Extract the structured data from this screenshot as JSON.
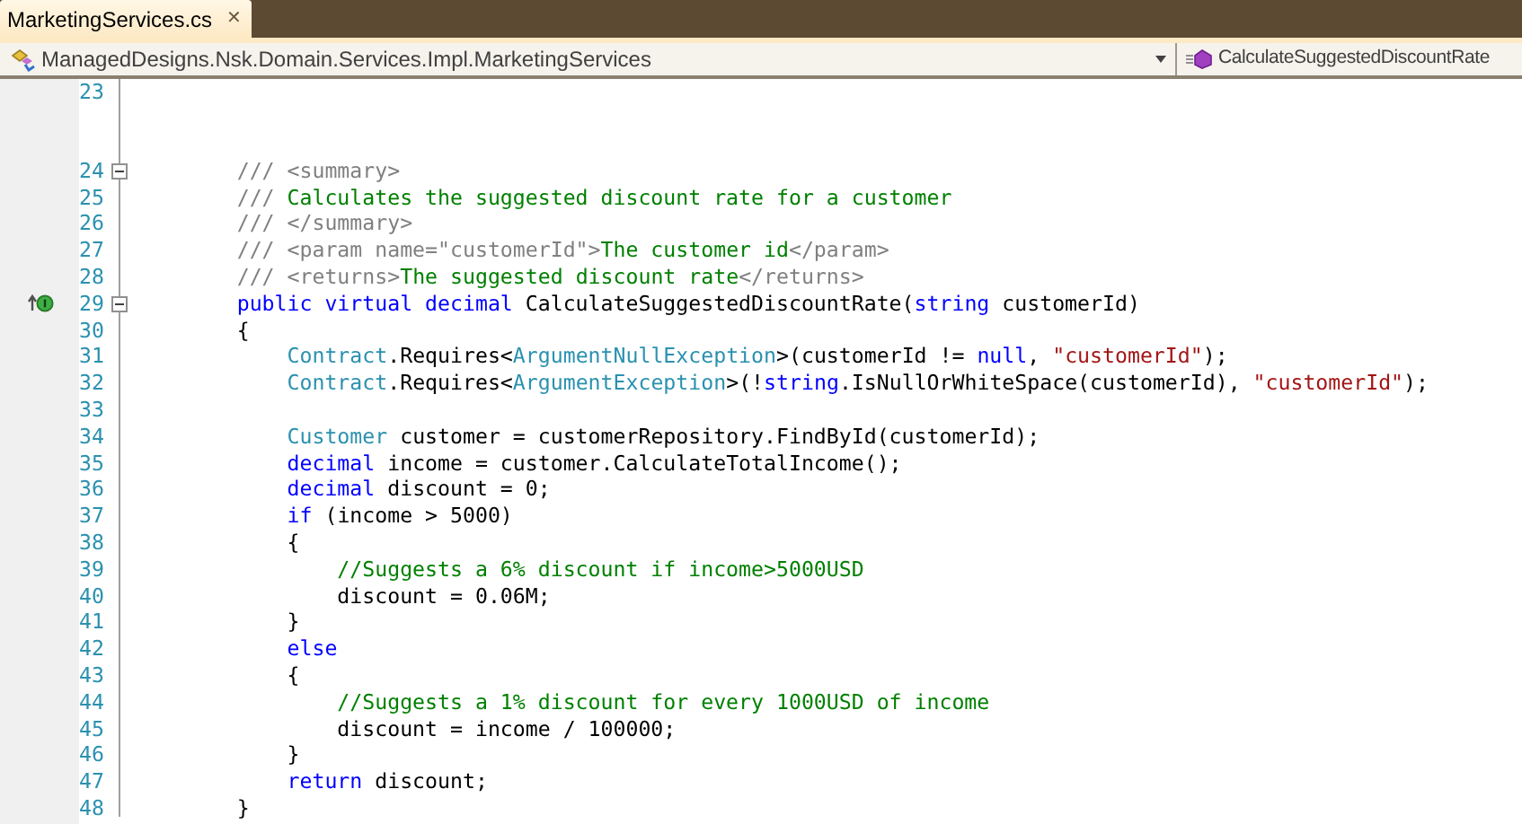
{
  "tab": {
    "title": "MarketingServices.cs",
    "close": "✕"
  },
  "navigation": {
    "type_dropdown": "ManagedDesigns.Nsk.Domain.Services.Impl.MarketingServices",
    "member_dropdown": "CalculateSuggestedDiscountRate"
  },
  "editor": {
    "lines": [
      {
        "number": "23"
      },
      {
        "number": "24",
        "expanded": true,
        "tokens": [
          {
            "kind": "doc",
            "text": "        /// <summary>"
          }
        ]
      },
      {
        "number": "25",
        "tokens": [
          {
            "kind": "doc",
            "text": "        ///"
          },
          {
            "kind": "comment",
            "text": " Calculates the suggested discount rate for a customer"
          }
        ]
      },
      {
        "number": "26",
        "tokens": [
          {
            "kind": "doc",
            "text": "        /// </summary>"
          }
        ]
      },
      {
        "number": "27",
        "tokens": [
          {
            "kind": "doc",
            "text": "        /// <param name=\"customerId\">"
          },
          {
            "kind": "comment",
            "text": "The customer id"
          },
          {
            "kind": "doc",
            "text": "</param>"
          }
        ]
      },
      {
        "number": "28",
        "tokens": [
          {
            "kind": "doc",
            "text": "        /// <returns>"
          },
          {
            "kind": "comment",
            "text": "The suggested discount rate"
          },
          {
            "kind": "doc",
            "text": "</returns>"
          }
        ]
      },
      {
        "number": "29",
        "expanded": true,
        "implementation_marker": true,
        "tokens": [
          {
            "kind": "keyword",
            "text": "        public virtual decimal"
          },
          {
            "kind": "plain",
            "text": " CalculateSuggestedDiscountRate("
          },
          {
            "kind": "keyword",
            "text": "string"
          },
          {
            "kind": "plain",
            "text": " customerId)"
          }
        ]
      },
      {
        "number": "30",
        "tokens": [
          {
            "kind": "plain",
            "text": "        {"
          }
        ]
      },
      {
        "number": "31",
        "tokens": [
          {
            "kind": "type",
            "text": "            Contract"
          },
          {
            "kind": "plain",
            "text": ".Requires<"
          },
          {
            "kind": "type",
            "text": "ArgumentNullException"
          },
          {
            "kind": "plain",
            "text": ">(customerId != "
          },
          {
            "kind": "keyword",
            "text": "null"
          },
          {
            "kind": "plain",
            "text": ", "
          },
          {
            "kind": "string",
            "text": "\"customerId\""
          },
          {
            "kind": "plain",
            "text": ");"
          }
        ]
      },
      {
        "number": "32",
        "tokens": [
          {
            "kind": "type",
            "text": "            Contract"
          },
          {
            "kind": "plain",
            "text": ".Requires<"
          },
          {
            "kind": "type",
            "text": "ArgumentException"
          },
          {
            "kind": "plain",
            "text": ">(!"
          },
          {
            "kind": "keyword",
            "text": "string"
          },
          {
            "kind": "plain",
            "text": ".IsNullOrWhiteSpace(customerId), "
          },
          {
            "kind": "string",
            "text": "\"customerId\""
          },
          {
            "kind": "plain",
            "text": ");"
          }
        ]
      },
      {
        "number": "33"
      },
      {
        "number": "34",
        "tokens": [
          {
            "kind": "type",
            "text": "            Customer"
          },
          {
            "kind": "plain",
            "text": " customer = customerRepository.FindById(customerId);"
          }
        ]
      },
      {
        "number": "35",
        "tokens": [
          {
            "kind": "keyword",
            "text": "            decimal"
          },
          {
            "kind": "plain",
            "text": " income = customer.CalculateTotalIncome();"
          }
        ]
      },
      {
        "number": "36",
        "tokens": [
          {
            "kind": "keyword",
            "text": "            decimal"
          },
          {
            "kind": "plain",
            "text": " discount = 0;"
          }
        ]
      },
      {
        "number": "37",
        "tokens": [
          {
            "kind": "keyword",
            "text": "            if"
          },
          {
            "kind": "plain",
            "text": " (income > 5000)"
          }
        ]
      },
      {
        "number": "38",
        "tokens": [
          {
            "kind": "plain",
            "text": "            {"
          }
        ]
      },
      {
        "number": "39",
        "tokens": [
          {
            "kind": "comment",
            "text": "                //Suggests a 6% discount if income>5000USD"
          }
        ]
      },
      {
        "number": "40",
        "tokens": [
          {
            "kind": "plain",
            "text": "                discount = 0.06M;"
          }
        ]
      },
      {
        "number": "41",
        "tokens": [
          {
            "kind": "plain",
            "text": "            }"
          }
        ]
      },
      {
        "number": "42",
        "tokens": [
          {
            "kind": "keyword",
            "text": "            else"
          }
        ]
      },
      {
        "number": "43",
        "tokens": [
          {
            "kind": "plain",
            "text": "            {"
          }
        ]
      },
      {
        "number": "44",
        "tokens": [
          {
            "kind": "comment",
            "text": "                //Suggests a 1% discount for every 1000USD of income"
          }
        ]
      },
      {
        "number": "45",
        "tokens": [
          {
            "kind": "plain",
            "text": "                discount = income / 100000;"
          }
        ]
      },
      {
        "number": "46",
        "tokens": [
          {
            "kind": "plain",
            "text": "            }"
          }
        ]
      },
      {
        "number": "47",
        "tokens": [
          {
            "kind": "keyword",
            "text": "            return"
          },
          {
            "kind": "plain",
            "text": " discount;"
          }
        ]
      },
      {
        "number": "48",
        "tokens": [
          {
            "kind": "plain",
            "text": "        }"
          }
        ]
      }
    ]
  }
}
